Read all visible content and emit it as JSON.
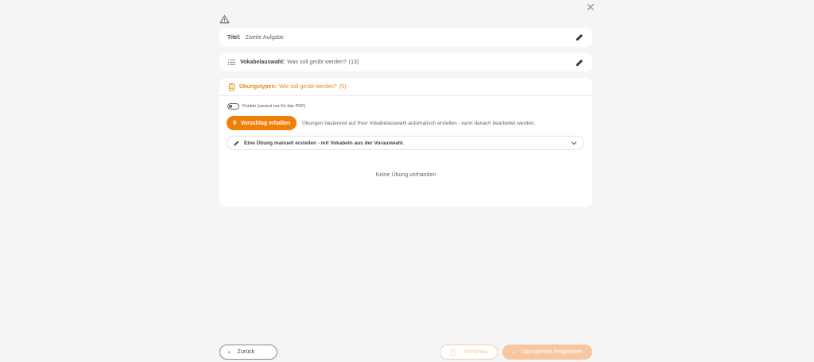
{
  "title_field": {
    "label": "Titel:",
    "value": "Zweite Aufgabe"
  },
  "vocab": {
    "label": "Vokabelauswahl:",
    "prompt": "Was soll geübt werden?",
    "count": "(13)"
  },
  "exercise_types": {
    "label": "Übungstypen:",
    "prompt": "Wie soll geübt werden?",
    "count": "(0)"
  },
  "points_toggle": {
    "label": "Punkte (vorerst nur für das PDF)",
    "on": false
  },
  "suggestion": {
    "button_label": "Vorschlag erhalten",
    "description": "Übungen basierend auf Ihrer Vokabelauswahl automatisch erstellen - kann danach bearbeitet werden."
  },
  "manual_create": {
    "label": "Eine Übung manuell erstellen - mit Vokabeln aus der Vorauswahl."
  },
  "empty_state": "Keine Übung vorhanden",
  "footer": {
    "back_label": "Zurück",
    "preview_label": "Vorschau",
    "finish_label": "Übungsreihe fertigstellen"
  },
  "colors": {
    "accent": "#f07f0a",
    "accent_light": "#f6c7a0",
    "background": "#f5f5f5",
    "card": "#ffffff"
  },
  "icons": [
    "close-icon",
    "warning-icon",
    "pencil-icon",
    "list-icon",
    "clipboard-icon",
    "magic-wand-icon",
    "chevron-down-icon",
    "chevron-left-icon",
    "document-icon",
    "check-icon"
  ]
}
